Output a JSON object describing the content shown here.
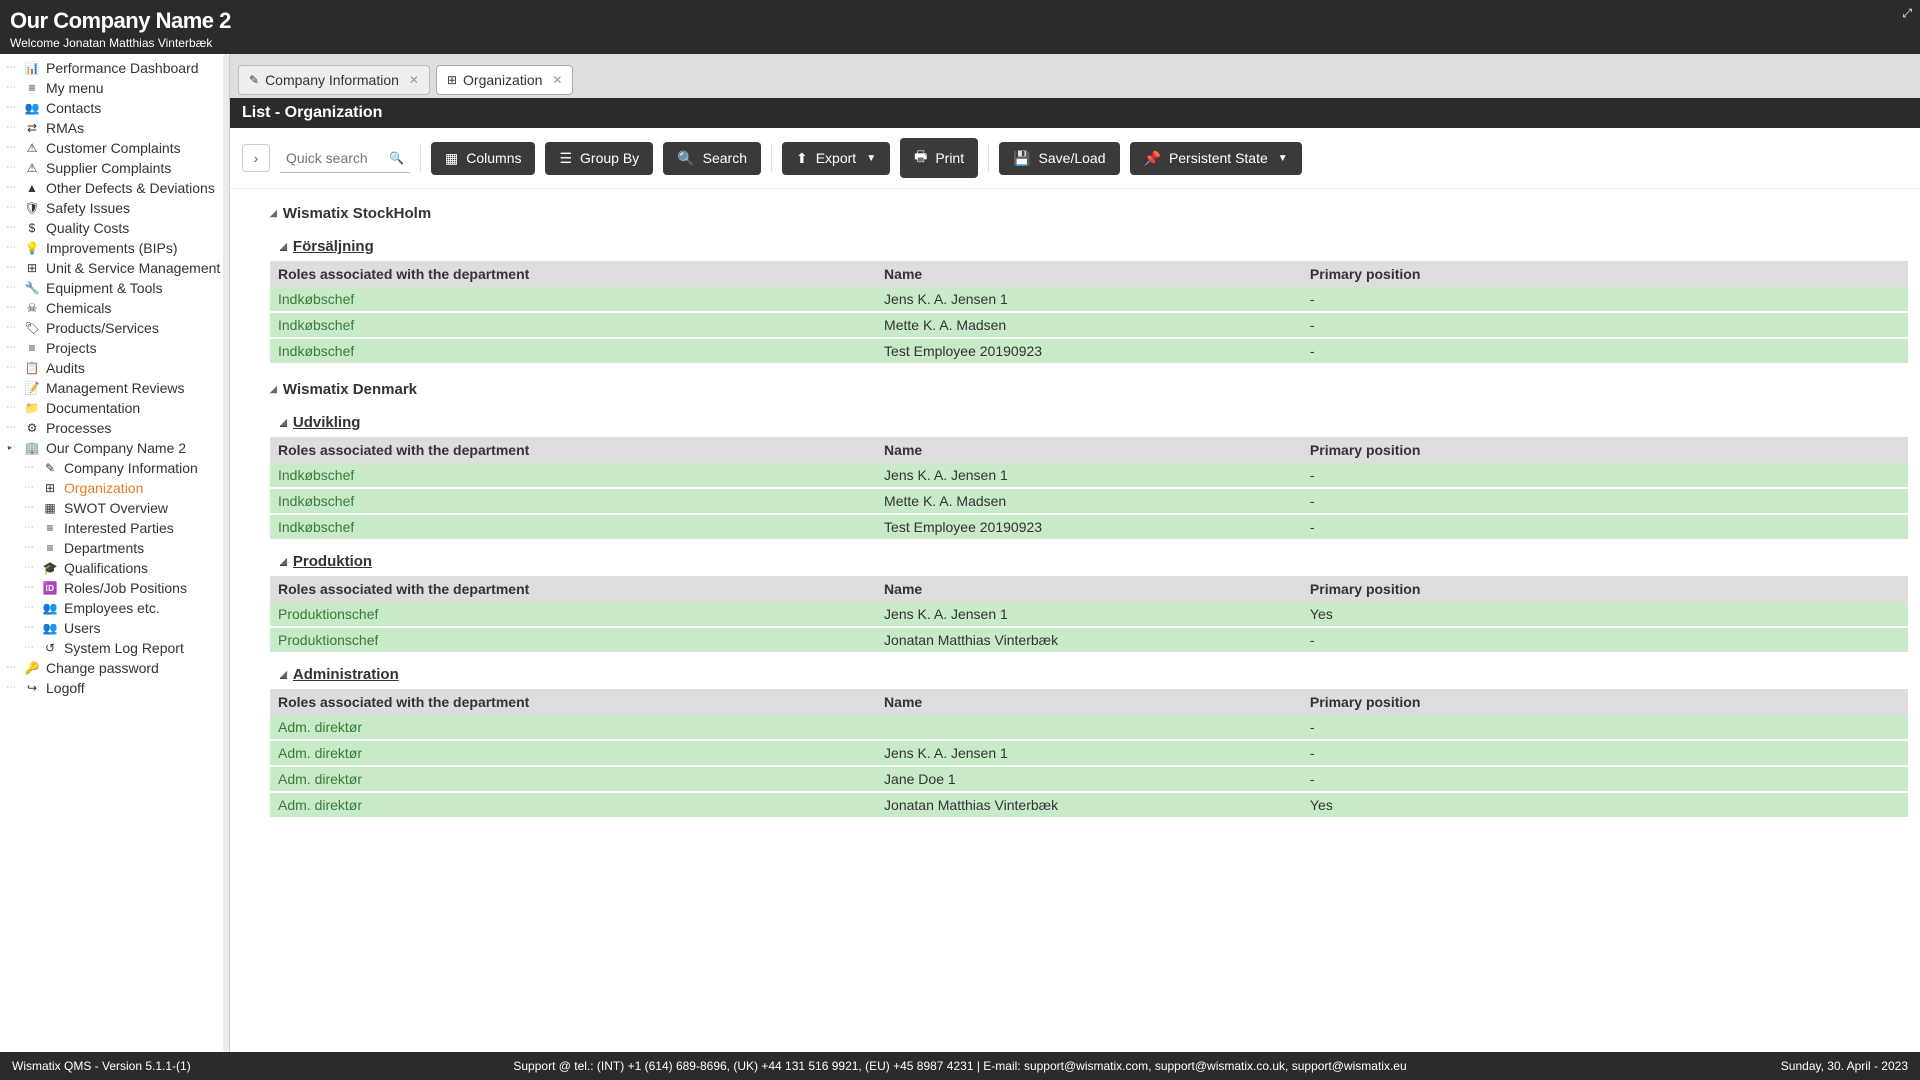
{
  "header": {
    "title": "Our Company Name 2",
    "welcome": "Welcome Jonatan Matthias Vinterbæk"
  },
  "sidebar": {
    "items": [
      {
        "icon": "dashboard",
        "label": "Performance Dashboard"
      },
      {
        "icon": "list",
        "label": "My menu"
      },
      {
        "icon": "contacts",
        "label": "Contacts"
      },
      {
        "icon": "exchange",
        "label": "RMAs"
      },
      {
        "icon": "person-warn",
        "label": "Customer Complaints"
      },
      {
        "icon": "truck-warn",
        "label": "Supplier Complaints"
      },
      {
        "icon": "warning",
        "label": "Other Defects & Deviations"
      },
      {
        "icon": "shield",
        "label": "Safety Issues"
      },
      {
        "icon": "money",
        "label": "Quality Costs"
      },
      {
        "icon": "lightbulb",
        "label": "Improvements (BIPs)"
      },
      {
        "icon": "sitemap",
        "label": "Unit & Service Management"
      },
      {
        "icon": "tools",
        "label": "Equipment & Tools"
      },
      {
        "icon": "skull",
        "label": "Chemicals"
      },
      {
        "icon": "tag",
        "label": "Products/Services"
      },
      {
        "icon": "list",
        "label": "Projects"
      },
      {
        "icon": "clipboard",
        "label": "Audits"
      },
      {
        "icon": "review",
        "label": "Management Reviews"
      },
      {
        "icon": "folder",
        "label": "Documentation"
      },
      {
        "icon": "process",
        "label": "Processes"
      },
      {
        "icon": "building",
        "label": "Our Company Name 2",
        "expandable": true
      }
    ],
    "children": [
      {
        "icon": "edit",
        "label": "Company Information"
      },
      {
        "icon": "org",
        "label": "Organization",
        "selected": true
      },
      {
        "icon": "grid",
        "label": "SWOT Overview"
      },
      {
        "icon": "list",
        "label": "Interested Parties"
      },
      {
        "icon": "list",
        "label": "Departments"
      },
      {
        "icon": "grad",
        "label": "Qualifications"
      },
      {
        "icon": "badge",
        "label": "Roles/Job Positions"
      },
      {
        "icon": "users",
        "label": "Employees etc."
      },
      {
        "icon": "users",
        "label": "Users"
      },
      {
        "icon": "history",
        "label": "System Log Report"
      }
    ],
    "bottom": [
      {
        "icon": "key",
        "label": "Change password"
      },
      {
        "icon": "logout",
        "label": "Logoff"
      }
    ]
  },
  "tabs": [
    {
      "icon": "edit",
      "label": "Company Information",
      "active": false
    },
    {
      "icon": "org",
      "label": "Organization",
      "active": true
    }
  ],
  "list_title": "List - Organization",
  "toolbar": {
    "search_placeholder": "Quick search",
    "columns": "Columns",
    "groupby": "Group By",
    "search": "Search",
    "export": "Export",
    "print": "Print",
    "saveload": "Save/Load",
    "persistent": "Persistent State"
  },
  "table_headers": {
    "role": "Roles associated with the department",
    "name": "Name",
    "primary": "Primary position"
  },
  "groups": [
    {
      "company": "Wismatix StockHolm",
      "departments": [
        {
          "name": "Försäljning",
          "rows": [
            {
              "role": "Indkøbschef",
              "name": "Jens K. A. Jensen 1",
              "primary": "-"
            },
            {
              "role": "Indkøbschef",
              "name": "Mette K. A. Madsen",
              "primary": "-"
            },
            {
              "role": "Indkøbschef",
              "name": "Test Employee 20190923",
              "primary": "-"
            }
          ]
        }
      ]
    },
    {
      "company": "Wismatix Denmark",
      "departments": [
        {
          "name": "Udvikling",
          "rows": [
            {
              "role": "Indkøbschef",
              "name": "Jens K. A. Jensen 1",
              "primary": "-"
            },
            {
              "role": "Indkøbschef",
              "name": "Mette K. A. Madsen",
              "primary": "-"
            },
            {
              "role": "Indkøbschef",
              "name": "Test Employee 20190923",
              "primary": "-"
            }
          ]
        },
        {
          "name": "Produktion",
          "rows": [
            {
              "role": "Produktionschef",
              "name": "Jens K. A. Jensen 1",
              "primary": "Yes"
            },
            {
              "role": "Produktionschef",
              "name": "Jonatan Matthias Vinterbæk",
              "primary": "-"
            }
          ]
        },
        {
          "name": "Administration",
          "rows": [
            {
              "role": "Adm. direktør",
              "name": "",
              "primary": "-"
            },
            {
              "role": "Adm. direktør",
              "name": "Jens K. A. Jensen 1",
              "primary": "-"
            },
            {
              "role": "Adm. direktør",
              "name": "Jane Doe 1",
              "primary": "-"
            },
            {
              "role": "Adm. direktør",
              "name": "Jonatan Matthias Vinterbæk",
              "primary": "Yes"
            }
          ]
        }
      ]
    }
  ],
  "footer": {
    "left": "Wismatix QMS - Version 5.1.1-(1)",
    "center": "Support @ tel.: (INT) +1 (614) 689-8696, (UK) +44 131 516 9921, (EU) +45 8987 4231 | E-mail: support@wismatix.com, support@wismatix.co.uk, support@wismatix.eu",
    "right": "Sunday, 30. April - 2023"
  }
}
